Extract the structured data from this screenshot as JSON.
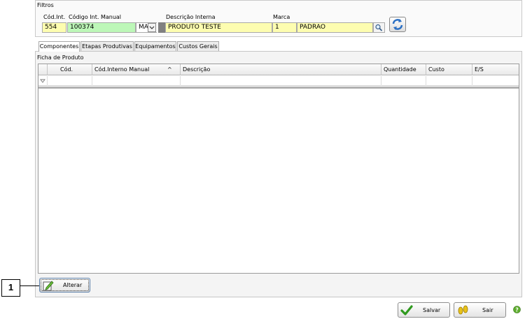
{
  "filters": {
    "title": "Filtros",
    "cod_int_label": "Cód.Int.",
    "cod_int_value": "554",
    "cod_manual_label": "Código Int. Manual",
    "cod_manual_value": "100374",
    "combo_value": "MA",
    "descricao_label": "Descrição Interna",
    "descricao_value": "PRODUTO TESTE",
    "marca_label": "Marca",
    "marca_code": "1",
    "marca_name": "PADRAO"
  },
  "tabs": [
    {
      "label": "Componentes"
    },
    {
      "label": "Etapas Produtivas"
    },
    {
      "label": "Equipamentos"
    },
    {
      "label": "Custos Gerais"
    }
  ],
  "panel": {
    "title": "Ficha de Produto"
  },
  "grid": {
    "columns": [
      "Cód.",
      "Cód.Interno Manual",
      "Descrição",
      "Quantidade",
      "Custo",
      "E/S"
    ],
    "sort_indicator": "^"
  },
  "buttons": {
    "alterar": "Alterar",
    "salvar": "Salvar",
    "sair": "Sair"
  },
  "callout": {
    "label": "1"
  },
  "colors": {
    "yellow_field": "#fdfdb0",
    "green_field": "#bdf7b8"
  }
}
